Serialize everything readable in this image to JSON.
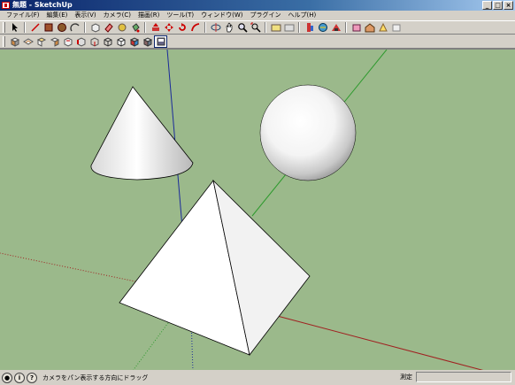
{
  "window": {
    "title": "無題 - SketchUp"
  },
  "menu": {
    "items": [
      "ファイル(F)",
      "編集(E)",
      "表示(V)",
      "カメラ(C)",
      "描画(R)",
      "ツール(T)",
      "ウィンドウ(W)",
      "プラグイン",
      "ヘルプ(H)"
    ]
  },
  "toolbar1": {
    "icons": [
      "select-icon",
      "line-icon",
      "rectangle-icon",
      "circle-icon",
      "arc-icon",
      "eraser-icon",
      "paint-bucket-icon",
      "push-pull-icon",
      "move-icon",
      "rotate-icon",
      "follow-me-icon",
      "orbit-icon",
      "pan-icon",
      "zoom-icon",
      "zoom-extents-icon",
      "previous-view-icon",
      "next-view-icon",
      "component-icon",
      "geo-location-icon",
      "shadow-icon",
      "photo-match-icon",
      "warehouse-icon",
      "share-icon"
    ]
  },
  "toolbar2": {
    "icons": [
      "iso-view-icon",
      "top-view-icon",
      "front-view-icon",
      "right-view-icon",
      "back-view-icon",
      "left-view-icon",
      "xray-icon",
      "wireframe-icon",
      "hidden-line-icon",
      "shaded-icon",
      "textured-icon",
      "monochrome-icon"
    ]
  },
  "viewport": {
    "background": "#9bb98b",
    "axis_colors": {
      "red": "#a02020",
      "green": "#2e9a2e",
      "blue": "#1a2a9a"
    },
    "objects": [
      "cone",
      "sphere",
      "pyramid"
    ]
  },
  "status": {
    "icons": [
      "geo-location-status-icon",
      "credits-status-icon",
      "help-status-icon"
    ],
    "hint": "カメラをパン表示する方向にドラッグ",
    "measurements_label": "測定",
    "measurements_value": ""
  }
}
